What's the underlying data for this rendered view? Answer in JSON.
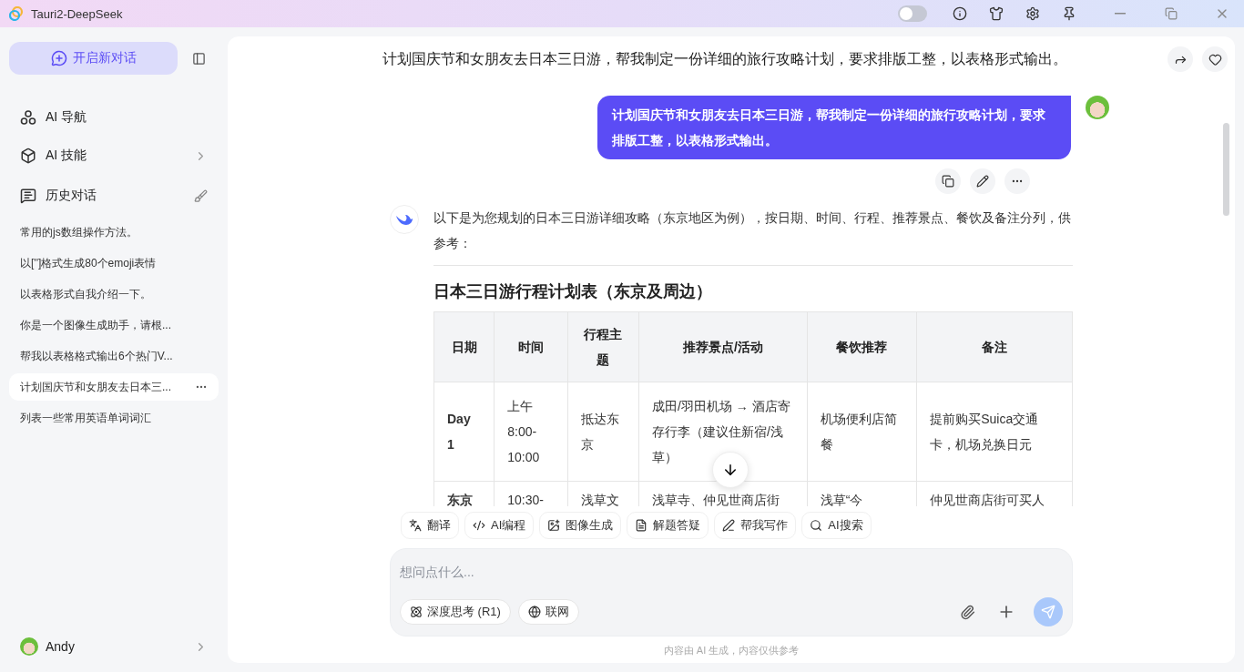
{
  "window": {
    "title": "Tauri2-DeepSeek",
    "theme_toggle": {
      "on": false
    }
  },
  "sidebar": {
    "new_chat": "开启新对话",
    "nav": [
      {
        "label": "AI 导航",
        "kind": "plain"
      },
      {
        "label": "AI 技能",
        "kind": "submenu"
      }
    ],
    "history": {
      "title": "历史对话",
      "items": [
        {
          "label": "常用的js数组操作方法。",
          "selected": false
        },
        {
          "label": "以['']格式生成80个emoji表情",
          "selected": false
        },
        {
          "label": "以表格形式自我介绍一下。",
          "selected": false
        },
        {
          "label": "你是一个图像生成助手，请根...",
          "selected": false
        },
        {
          "label": "帮我以表格格式输出6个热门V...",
          "selected": false
        },
        {
          "label": "计划国庆节和女朋友去日本三...",
          "selected": true
        },
        {
          "label": "列表一些常用英语单词词汇",
          "selected": false
        }
      ]
    },
    "user": {
      "name": "Andy"
    }
  },
  "chat": {
    "title": "计划国庆节和女朋友去日本三日游，帮我制定一份详细的旅行攻略计划，要求排版工整，以表格形式输出。",
    "messages": [
      {
        "kind": "user",
        "text": "计划国庆节和女朋友去日本三日游，帮我制定一份详细的旅行攻略计划，要求排版工整，以表格形式输出。"
      },
      {
        "kind": "assistant",
        "intro": "以下是为您规划的日本三日游详细攻略（东京地区为例），按日期、时间、行程、推荐景点、餐饮及备注分列，供参考：",
        "heading": "日本三日游行程计划表（东京及周边）",
        "table": {
          "columns": [
            "日期",
            "时间",
            "行程主题",
            "推荐景点/活动",
            "餐饮推荐",
            "备注"
          ],
          "rows": [
            [
              "Day 1",
              "上午 8:00-10:00",
              "抵达东京",
              "成田/羽田机场 → 酒店寄存行李（建议住新宿/浅草）",
              "机场便利店简餐",
              "提前购买Suica交通卡，机场兑换日元"
            ],
            [
              "东京",
              "10:30-",
              "浅草文",
              "浅草寺、仲见世商店街",
              "浅草“今",
              "仲见世商店街可买人"
            ]
          ]
        }
      }
    ]
  },
  "quick_actions": [
    "翻译",
    "AI编程",
    "图像生成",
    "解题答疑",
    "帮我写作",
    "AI搜索"
  ],
  "composer": {
    "placeholder": "想问点什么...",
    "toggles": [
      {
        "label": "深度思考 (R1)",
        "selected": false
      },
      {
        "label": "联网",
        "selected": false
      }
    ]
  },
  "footer": "内容由 AI 生成，内容仅供参考"
}
